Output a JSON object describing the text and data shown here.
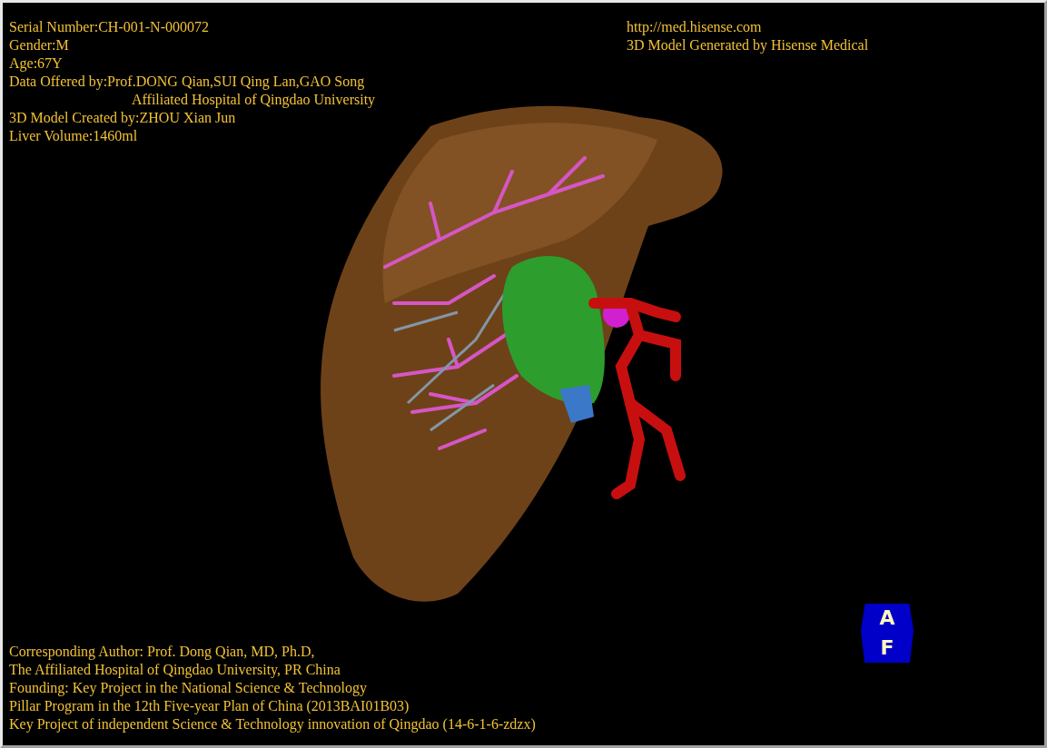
{
  "patient_info": [
    {
      "text": "Serial Number:CH-001-N-000072",
      "kind": "line"
    },
    {
      "text": "Gender:M",
      "kind": "line"
    },
    {
      "text": "Age:67Y",
      "kind": "line"
    },
    {
      "text": "Data Offered by:Prof.DONG Qian,SUI Qing Lan,GAO Song",
      "kind": "line"
    },
    {
      "text": "Affiliated Hospital of Qingdao University",
      "kind": "continued"
    },
    {
      "text": "3D Model Created by:ZHOU Xian Jun",
      "kind": "line"
    },
    {
      "text": "Liver Volume:1460ml",
      "kind": "line"
    }
  ],
  "generator_info": [
    "http://med.hisense.com",
    "3D Model Generated by Hisense Medical"
  ],
  "credits": [
    "Corresponding Author: Prof. Dong Qian, MD, Ph.D,",
    "The Affiliated Hospital of Qingdao University, PR China",
    "Founding: Key Project in the National Science & Technology",
    "Pillar Program in the 12th Five-year Plan of China (2013BAI01B03)",
    "Key Project of independent Science & Technology innovation of Qingdao (14-6-1-6-zdzx)"
  ],
  "orientation_cube": {
    "top_label": "A",
    "bottom_label": "F"
  }
}
